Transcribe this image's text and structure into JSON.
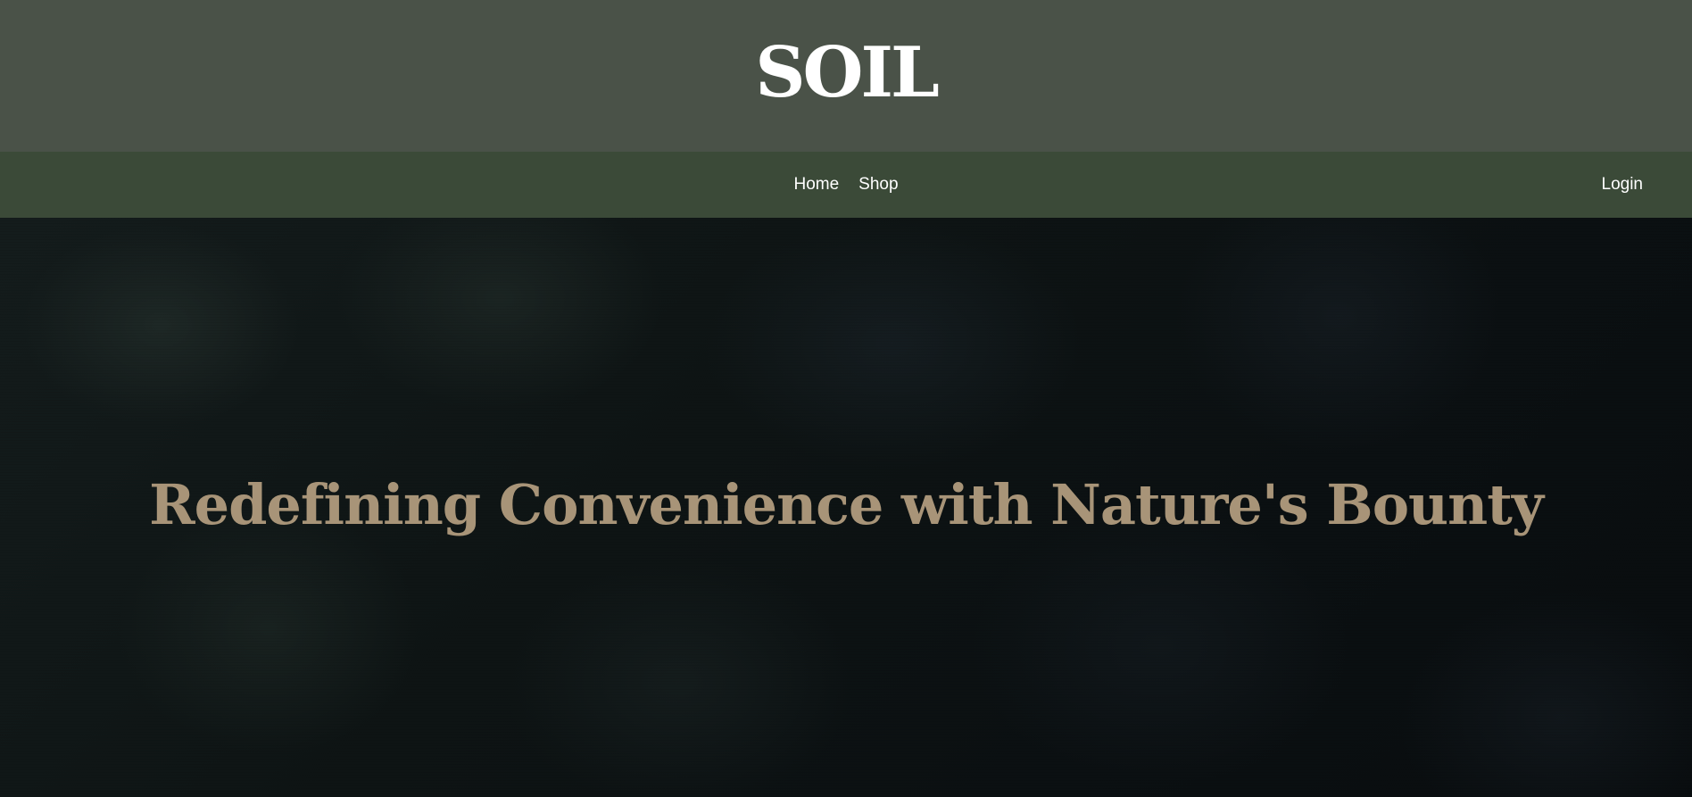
{
  "header": {
    "logo_text": "SOIL"
  },
  "nav": {
    "items": [
      {
        "label": "Home"
      },
      {
        "label": "Shop"
      }
    ],
    "login_label": "Login"
  },
  "hero": {
    "title": "Redefining Convenience with Nature's Bounty"
  },
  "colors": {
    "header_bg": "#4a5248",
    "navbar_bg": "#3b4a38",
    "hero_title": "#a89478",
    "hero_bg": "#0e1414"
  }
}
